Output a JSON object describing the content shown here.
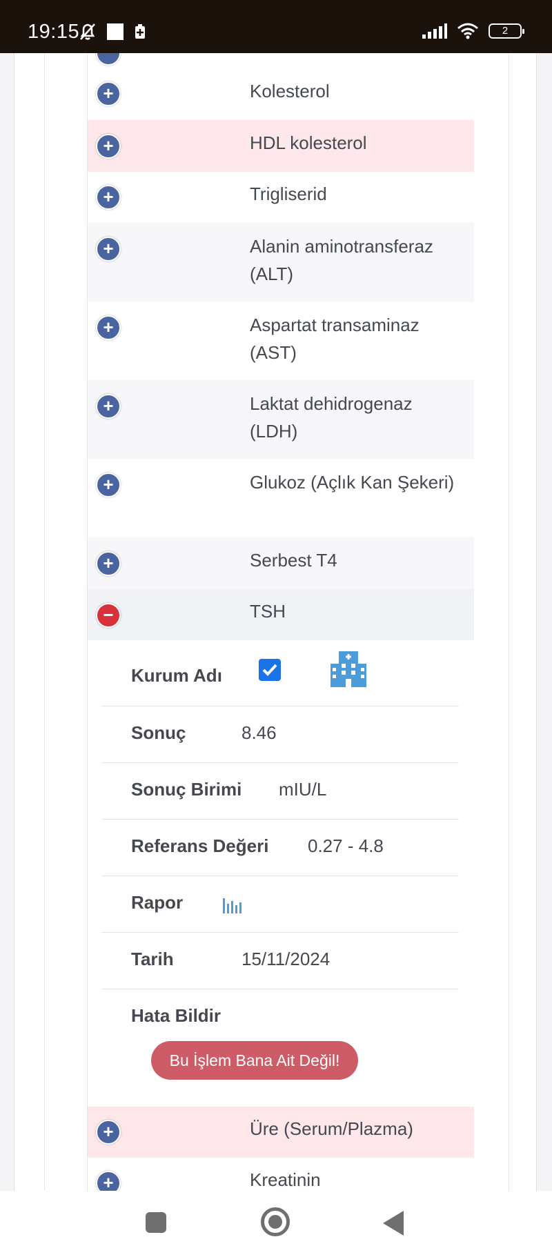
{
  "status_bar": {
    "time": "19:15",
    "battery": "2"
  },
  "list": {
    "rows": [
      {
        "label": "Kolesterol"
      },
      {
        "label": "HDL kolesterol"
      },
      {
        "label": "Trigliserid"
      },
      {
        "label": "Alanin aminotransferaz (ALT)"
      },
      {
        "label": "Aspartat transaminaz (AST)"
      },
      {
        "label": "Laktat dehidrogenaz (LDH)"
      },
      {
        "label": "Glukoz (Açlık Kan Şekeri)"
      },
      {
        "label": "Serbest T4"
      },
      {
        "label": "TSH"
      },
      {
        "label": "Üre (Serum/Plazma)"
      },
      {
        "label": "Kreatinin"
      }
    ]
  },
  "detail": {
    "kurum_label": "Kurum Adı",
    "kurum_checked": true,
    "sonuc_label": "Sonuç",
    "sonuc_value": "8.46",
    "birim_label": "Sonuç Birimi",
    "birim_value": "mIU/L",
    "referans_label": "Referans Değeri",
    "referans_value": "0.27 - 4.8",
    "rapor_label": "Rapor",
    "tarih_label": "Tarih",
    "tarih_value": "15/11/2024",
    "hata_label": "Hata Bildir",
    "hata_button": "Bu İşlem Bana Ait Değil!"
  },
  "colors": {
    "plus_button": "#4a64a0",
    "minus_button": "#d8313a",
    "highlight_row": "#fde7ea",
    "error_button": "#cd5c66",
    "checkbox": "#1a73e8"
  }
}
